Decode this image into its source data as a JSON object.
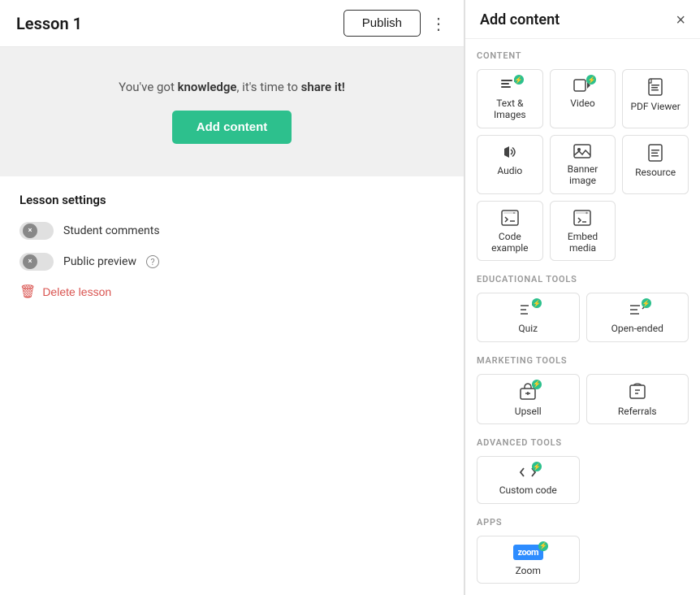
{
  "left": {
    "title": "Lesson 1",
    "publish_label": "Publish",
    "content_message": "You've got knowledge, it's time to share it!",
    "add_content_label": "Add content",
    "settings": {
      "title": "Lesson settings",
      "student_comments": "Student comments",
      "public_preview": "Public preview",
      "delete_label": "Delete lesson"
    }
  },
  "right": {
    "title": "Add content",
    "close_label": "×",
    "sections": {
      "content_label": "CONTENT",
      "educational_label": "EDUCATIONAL TOOLS",
      "marketing_label": "MARKETING TOOLS",
      "advanced_label": "ADVANCED TOOLS",
      "apps_label": "APPS"
    },
    "content_tools": [
      {
        "id": "text-images",
        "label": "Text & Images",
        "icon": "text",
        "badge": true
      },
      {
        "id": "video",
        "label": "Video",
        "icon": "video",
        "badge": true
      },
      {
        "id": "pdf-viewer",
        "label": "PDF Viewer",
        "icon": "pdf",
        "badge": false
      },
      {
        "id": "audio",
        "label": "Audio",
        "icon": "audio",
        "badge": false
      },
      {
        "id": "banner-image",
        "label": "Banner image",
        "icon": "banner",
        "badge": false
      },
      {
        "id": "resource",
        "label": "Resource",
        "icon": "resource",
        "badge": false
      },
      {
        "id": "code-example",
        "label": "Code example",
        "icon": "code-ex",
        "badge": false
      },
      {
        "id": "embed-media",
        "label": "Embed media",
        "icon": "embed",
        "badge": false
      }
    ],
    "educational_tools": [
      {
        "id": "quiz",
        "label": "Quiz",
        "icon": "quiz",
        "badge": true
      },
      {
        "id": "open-ended",
        "label": "Open-ended",
        "icon": "open-ended",
        "badge": true
      }
    ],
    "marketing_tools": [
      {
        "id": "upsell",
        "label": "Upsell",
        "icon": "upsell",
        "badge": true
      },
      {
        "id": "referrals",
        "label": "Referrals",
        "icon": "referrals",
        "badge": false
      }
    ],
    "advanced_tools": [
      {
        "id": "custom-code",
        "label": "Custom code",
        "icon": "custom-code",
        "badge": true
      }
    ],
    "apps": [
      {
        "id": "zoom",
        "label": "Zoom",
        "icon": "zoom",
        "badge": true
      }
    ]
  }
}
